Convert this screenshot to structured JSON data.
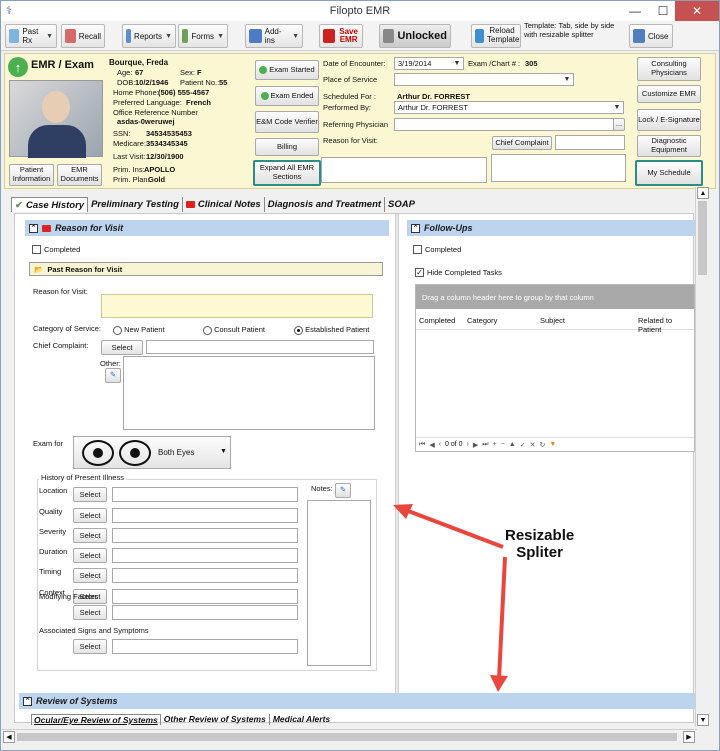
{
  "window": {
    "title": "Filopto EMR",
    "minimize": "—",
    "maximize": "☐",
    "close": "✕"
  },
  "toolbar": {
    "past_rx": "Past Rx",
    "recall": "Recall",
    "reports": "Reports",
    "forms": "Forms",
    "addins": "Add-ins",
    "save_emr": "Save EMR",
    "unlocked": "Unlocked",
    "reload_template": "Reload Template",
    "template_note": "Template: Tab, side by side with resizable splitter",
    "close": "Close"
  },
  "patient": {
    "module_title": "EMR / Exam",
    "name": "Bourque, Freda",
    "age_label": "Age:",
    "age": "67",
    "sex_label": "Sex:",
    "sex": "F",
    "dob_label": "DOB:",
    "dob": "10/2/1946",
    "patient_no_label": "Patient No.:",
    "patient_no": "55",
    "home_phone_label": "Home Phone:",
    "home_phone": "(506) 555-4567",
    "pref_lang_label": "Preferred Language:",
    "pref_lang": "French",
    "office_ref_label": "Office Reference Number",
    "office_ref": "asdas-0weruwej",
    "ssn_label": "SSN:",
    "ssn": "34534535453",
    "medicare_label": "Medicare:",
    "medicare": "3534345345",
    "last_visit_label": "Last Visit:",
    "last_visit": "12/30/1900",
    "prim_ins_label": "Prim. Ins:",
    "prim_ins": "APOLLO",
    "prim_plan_label": "Prim. Plan:",
    "prim_plan": "Gold",
    "patient_info_btn": "Patient Information",
    "emr_documents_btn": "EMR Documents"
  },
  "encounter": {
    "exam_started": "Exam Started",
    "exam_ended": "Exam Ended",
    "em_code": "E&M Code Verifier",
    "billing": "Billing",
    "expand_all": "Expand All EMR Sections",
    "date_label": "Date of Encounter:",
    "date": "3/19/2014",
    "exam_chart_label": "Exam /Chart # :",
    "exam_chart": "305",
    "place_label": "Place of Service",
    "scheduled_label": "Scheduled For :",
    "scheduled": "Arthur  Dr. FORREST",
    "performed_label": "Performed By:",
    "performed": "Arthur  Dr. FORREST",
    "referring_label": "Referring Physician",
    "reason_label": "Reason for Visit:",
    "chief_complaint_btn": "Chief Complaint"
  },
  "right_buttons": {
    "consulting": "Consulting Physicians",
    "customize": "Customize EMR",
    "lock": "Lock / E-Signature",
    "diagnostic": "Diagnostic Equipment",
    "schedule": "My Schedule"
  },
  "tabs": [
    "Case History",
    "Preliminary Testing",
    "Clinical Notes",
    "Diagnosis and Treatment",
    "SOAP"
  ],
  "reason_section": {
    "title": "Reason for Visit",
    "completed": "Completed",
    "past_reason": "Past Reason for Visit",
    "reason_label": "Reason for Visit:",
    "category_label": "Category of Service:",
    "new_patient": "New Patient",
    "consult_patient": "Consult Patient",
    "established_patient": "Established Patient",
    "chief_complaint_label": "Chief Complaint:",
    "select": "Select",
    "other_label": "Other:",
    "exam_for_label": "Exam for",
    "both_eyes": "Both Eyes",
    "hpi_title": "History of Present Illness",
    "notes_label": "Notes:",
    "hpi_rows": [
      "Location",
      "Quality",
      "Severity",
      "Duration",
      "Timing",
      "Context",
      "Modifying Factors",
      "Associated Signs and Symptoms"
    ]
  },
  "followups": {
    "title": "Follow-Ups",
    "completed": "Completed",
    "hide_completed": "Hide Completed Tasks",
    "group_hint": "Drag a column header here to group by that column",
    "columns": [
      "Completed",
      "Category",
      "Subject",
      "Related to Patient"
    ],
    "pager": "0 of 0"
  },
  "review": {
    "title": "Review of Systems",
    "tabs": [
      "Ocular/Eye Review of Systems",
      "Other Review of Systems",
      "Medical Alerts"
    ]
  },
  "annotation": {
    "line1": "Resizable",
    "line2": "Spliter"
  },
  "colors": {
    "header_bg": "#fbf7d3",
    "section_header": "#bcd4ee",
    "arrow": "#e8463e",
    "teal": "#2e8c86"
  }
}
